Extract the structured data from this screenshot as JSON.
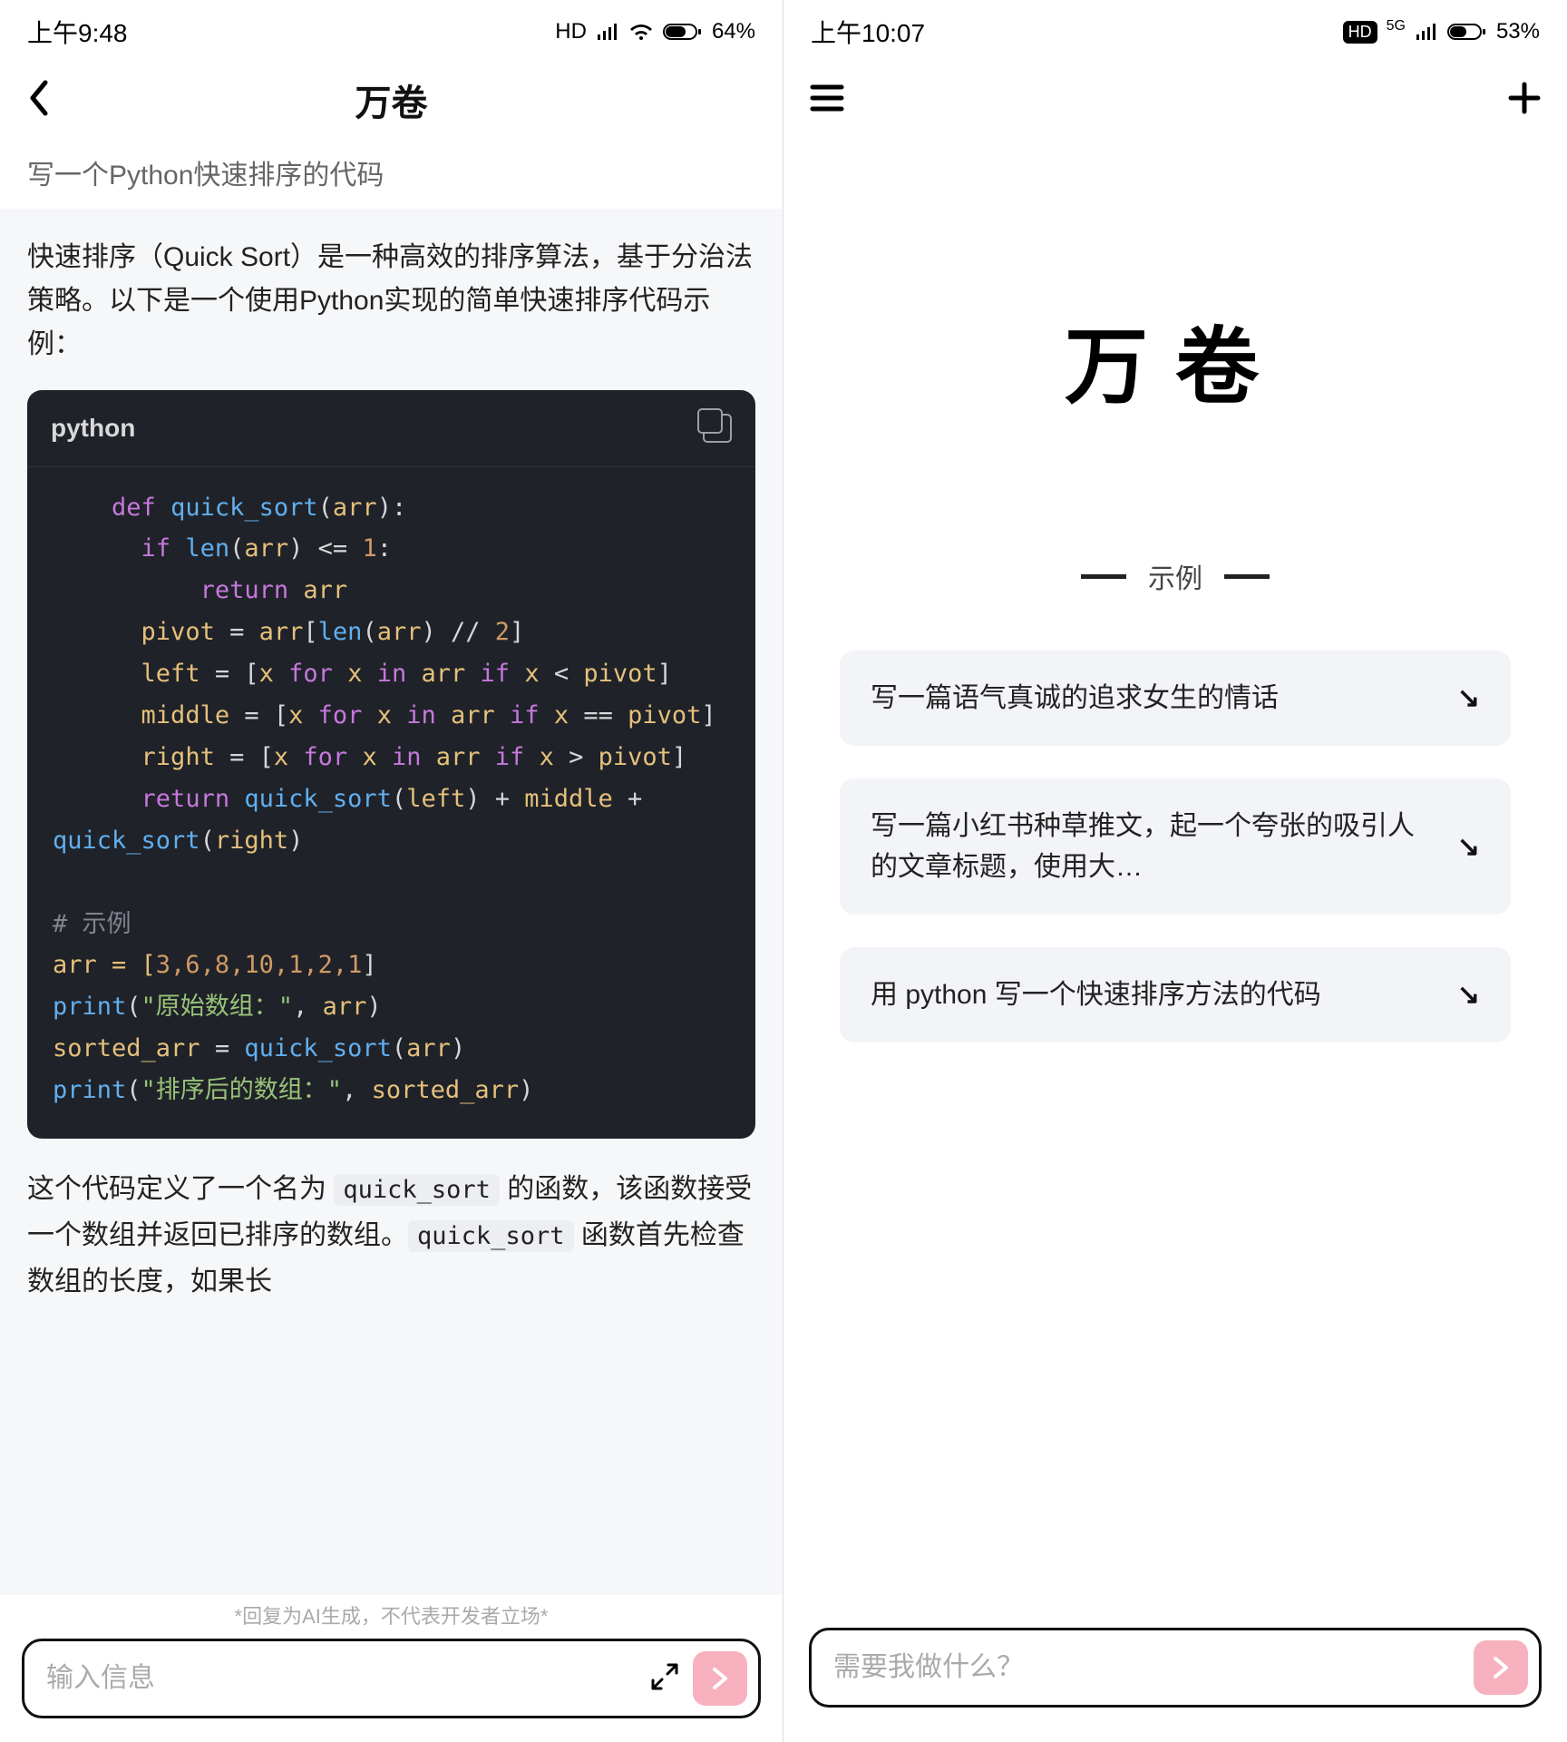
{
  "left": {
    "status": {
      "time": "上午9:48",
      "net": "HD",
      "battery": "64%"
    },
    "nav": {
      "title": "万卷"
    },
    "prompt": "写一个Python快速排序的代码",
    "answer_intro": "快速排序（Quick Sort）是一种高效的排序算法，基于分治法策略。以下是一个使用Python实现的简单快速排序代码示例：",
    "code_lang": "python",
    "code_tokens": {
      "def": "def",
      "func": "quick_sort",
      "arr": "arr",
      "if": "if",
      "len": "len",
      "le": " <= ",
      "one": "1",
      "return": "return",
      "pivot": "pivot",
      "two": "2",
      "left": "left",
      "for": "for",
      "in": "in",
      "x": "x",
      "mid": "middle",
      "right": "right",
      "eq": " == ",
      "ex": "# 示例",
      "arrv": "arr = [",
      "nums": "3,6,8,10,1,2,1",
      "print": "print",
      "s1": "\"原始数组：\"",
      "s2": "\"排序后的数组：\"",
      "sorted": "sorted_arr"
    },
    "answer_after_1": "这个代码定义了一个名为 ",
    "answer_after_2": " 的函数，该函数接受一个数组并返回已排序的数组。",
    "answer_after_3": " 函数首先检查数组的长度，如果长",
    "inline1": "quick_sort",
    "inline2": "quick_sort",
    "disclaimer": "*回复为AI生成，不代表开发者立场*",
    "input_placeholder": "输入信息"
  },
  "right": {
    "status": {
      "time": "上午10:07",
      "net": "HD",
      "sig": "5G",
      "battery": "53%"
    },
    "brand": "万卷",
    "example_label": "示例",
    "examples": [
      "写一篇语气真诚的追求女生的情话",
      "写一篇小红书种草推文，起一个夸张的吸引人的文章标题，使用大…",
      "用 python 写一个快速排序方法的代码"
    ],
    "input_placeholder": "需要我做什么？"
  }
}
